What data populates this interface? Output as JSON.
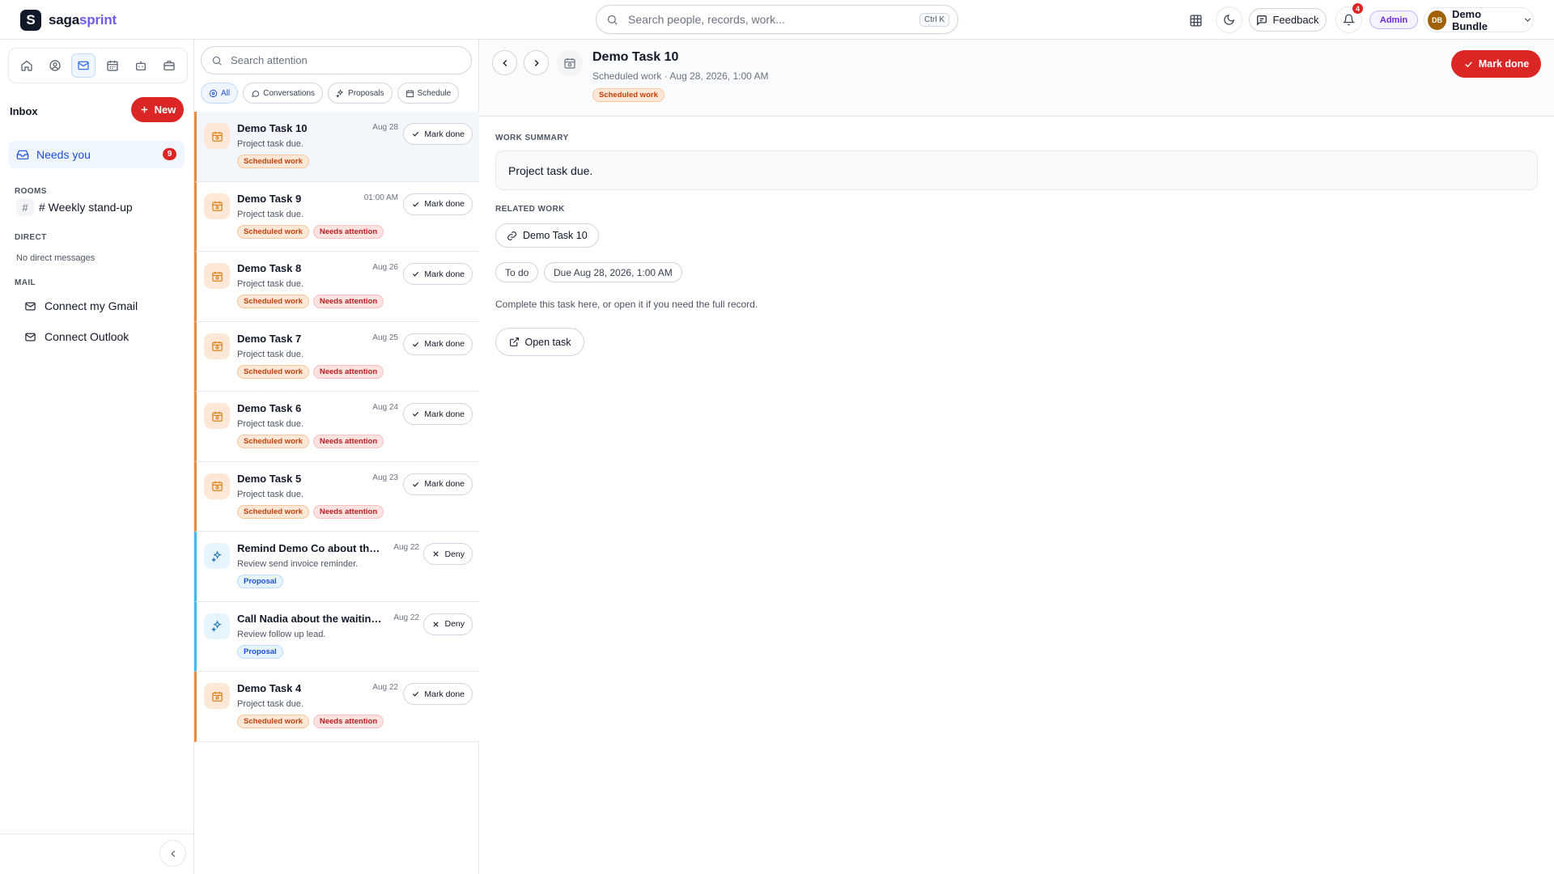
{
  "app": {
    "brand_first": "saga",
    "brand_second": "sprint",
    "logo_letter": "S"
  },
  "topbar": {
    "search_placeholder": "Search people, records, work...",
    "search_shortcut": "Ctrl K",
    "feedback_label": "Feedback",
    "notification_count": "4",
    "admin_label": "Admin",
    "account_initials": "DB",
    "account_name": "Demo Bundle"
  },
  "sidebar": {
    "inbox_title": "Inbox",
    "new_label": "New",
    "needs_you_label": "Needs you",
    "needs_you_count": "9",
    "rooms_heading": "ROOMS",
    "room_hash": "#",
    "room_name": "# Weekly stand-up",
    "direct_heading": "DIRECT",
    "direct_empty": "No direct messages",
    "mail_heading": "MAIL",
    "mail_items": [
      "Connect my Gmail",
      "Connect Outlook"
    ]
  },
  "list": {
    "search_placeholder": "Search attention",
    "filters": [
      "All",
      "Conversations",
      "Proposals",
      "Schedule"
    ],
    "items": [
      {
        "title": "Demo Task 10",
        "date": "Aug 28",
        "subtitle": "Project task due.",
        "tags": [
          "Scheduled work"
        ],
        "action": "Mark done"
      },
      {
        "title": "Demo Task 9",
        "date": "01:00 AM",
        "subtitle": "Project task due.",
        "tags": [
          "Scheduled work",
          "Needs attention"
        ],
        "action": "Mark done"
      },
      {
        "title": "Demo Task 8",
        "date": "Aug 26",
        "subtitle": "Project task due.",
        "tags": [
          "Scheduled work",
          "Needs attention"
        ],
        "action": "Mark done"
      },
      {
        "title": "Demo Task 7",
        "date": "Aug 25",
        "subtitle": "Project task due.",
        "tags": [
          "Scheduled work",
          "Needs attention"
        ],
        "action": "Mark done"
      },
      {
        "title": "Demo Task 6",
        "date": "Aug 24",
        "subtitle": "Project task due.",
        "tags": [
          "Scheduled work",
          "Needs attention"
        ],
        "action": "Mark done"
      },
      {
        "title": "Demo Task 5",
        "date": "Aug 23",
        "subtitle": "Project task due.",
        "tags": [
          "Scheduled work",
          "Needs attention"
        ],
        "action": "Mark done"
      },
      {
        "title": "Remind Demo Co about the d...",
        "date": "Aug 22",
        "subtitle": "Review send invoice reminder.",
        "tags": [
          "Proposal"
        ],
        "action": "Deny"
      },
      {
        "title": "Call Nadia about the waiting e...",
        "date": "Aug 22",
        "subtitle": "Review follow up lead.",
        "tags": [
          "Proposal"
        ],
        "action": "Deny"
      },
      {
        "title": "Demo Task 4",
        "date": "Aug 22",
        "subtitle": "Project task due.",
        "tags": [
          "Scheduled work",
          "Needs attention"
        ],
        "action": "Mark done"
      }
    ]
  },
  "detail": {
    "title": "Demo Task 10",
    "subtitle": "Scheduled work · Aug 28, 2026, 1:00 AM",
    "tag": "Scheduled work",
    "mark_done_label": "Mark done",
    "summary_heading": "WORK SUMMARY",
    "summary_text": "Project task due.",
    "related_heading": "RELATED WORK",
    "related_item": "Demo Task 10",
    "status": "To do",
    "due": "Due Aug 28, 2026, 1:00 AM",
    "help_text": "Complete this task here, or open it if you need the full record.",
    "open_task_label": "Open task"
  },
  "colors": {
    "primary_red": "#dc2626",
    "accent_blue": "#1d4ed8",
    "schedule_orange": "#ea8a3c",
    "proposal_blue": "#38bdf8",
    "brand_purple": "#6d5ce7"
  }
}
